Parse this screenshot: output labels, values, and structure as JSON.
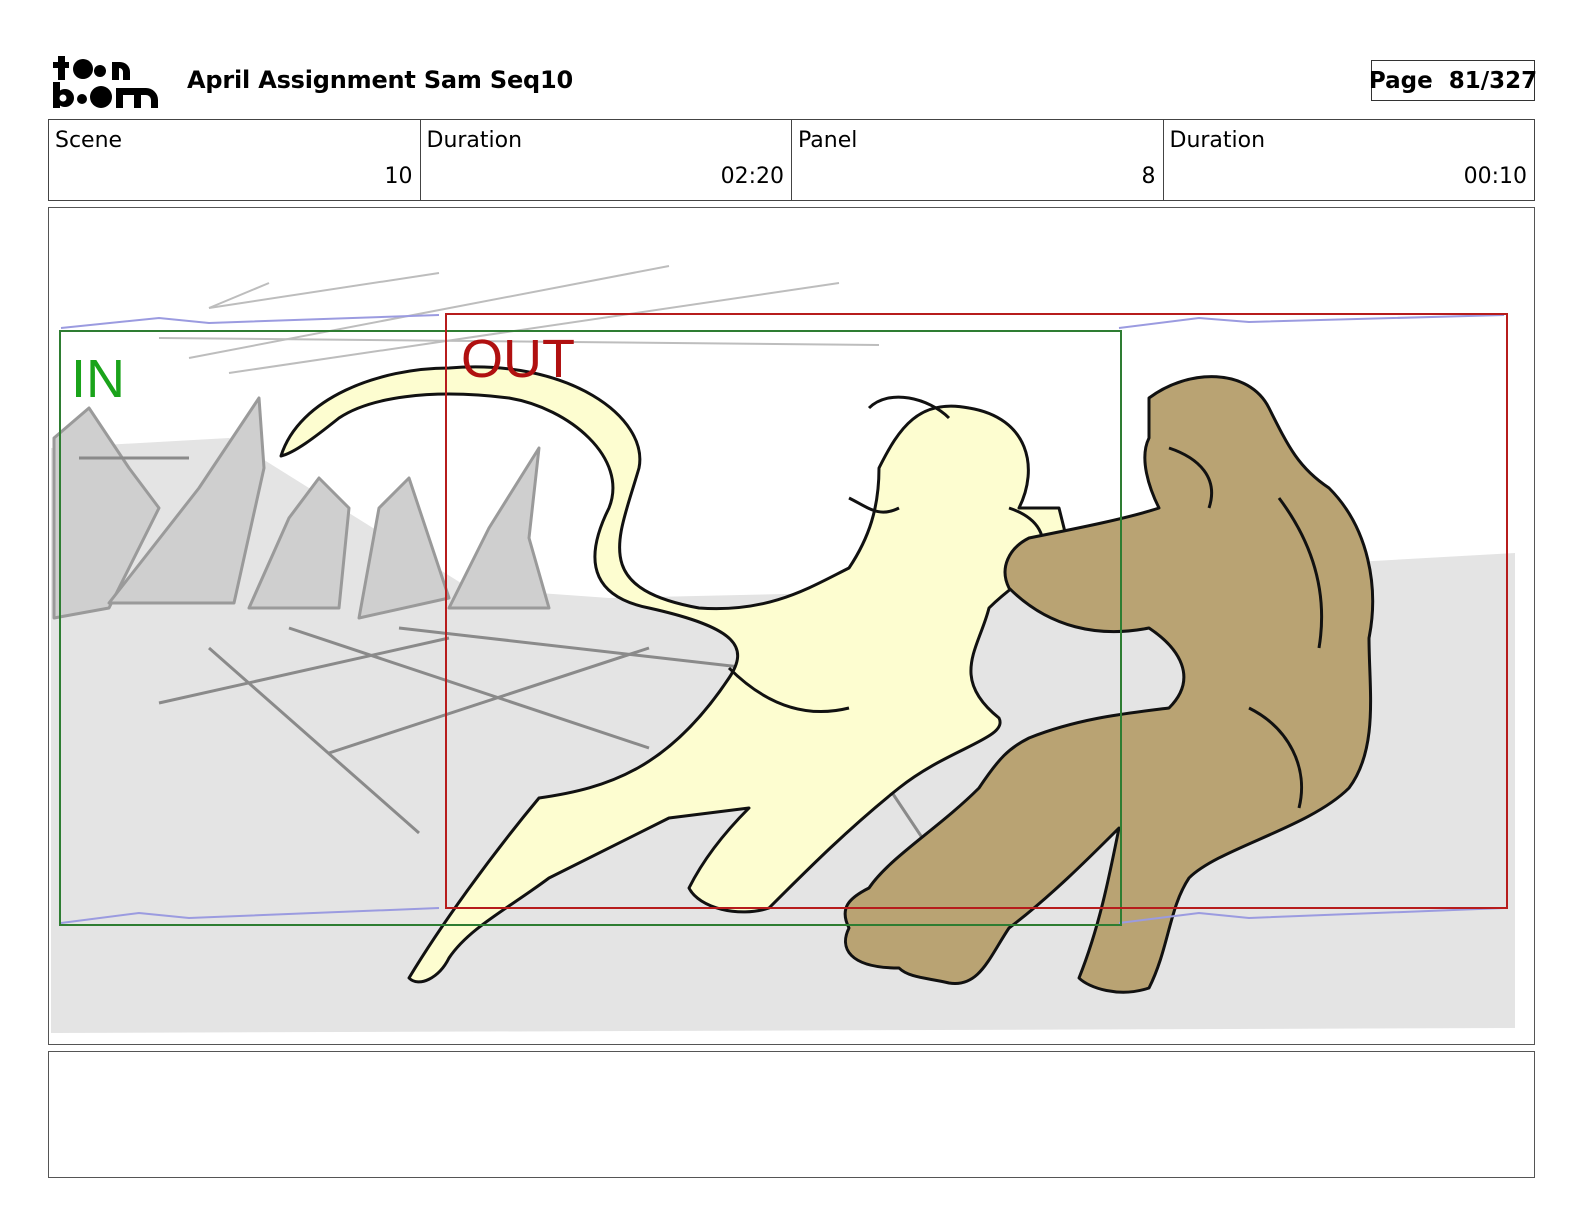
{
  "header": {
    "logo_text": "toon boom",
    "title": "April Assignment Sam Seq10",
    "page_label": "Page",
    "page_value": "81/327"
  },
  "info": [
    {
      "label": "Scene",
      "value": "10"
    },
    {
      "label": "Duration",
      "value": "02:20"
    },
    {
      "label": "Panel",
      "value": "8"
    },
    {
      "label": "Duration",
      "value": "00:10"
    }
  ],
  "panel": {
    "in_label": "IN",
    "out_label": "OUT",
    "colors": {
      "in_frame": "#2e7d32",
      "out_frame": "#b71c1c",
      "ground": "#e4e4e4",
      "figure_light": "#fdfdd0",
      "figure_dark": "#b9a373",
      "motion_arrow": "#9b9be0"
    }
  },
  "notes": {
    "text": ""
  }
}
